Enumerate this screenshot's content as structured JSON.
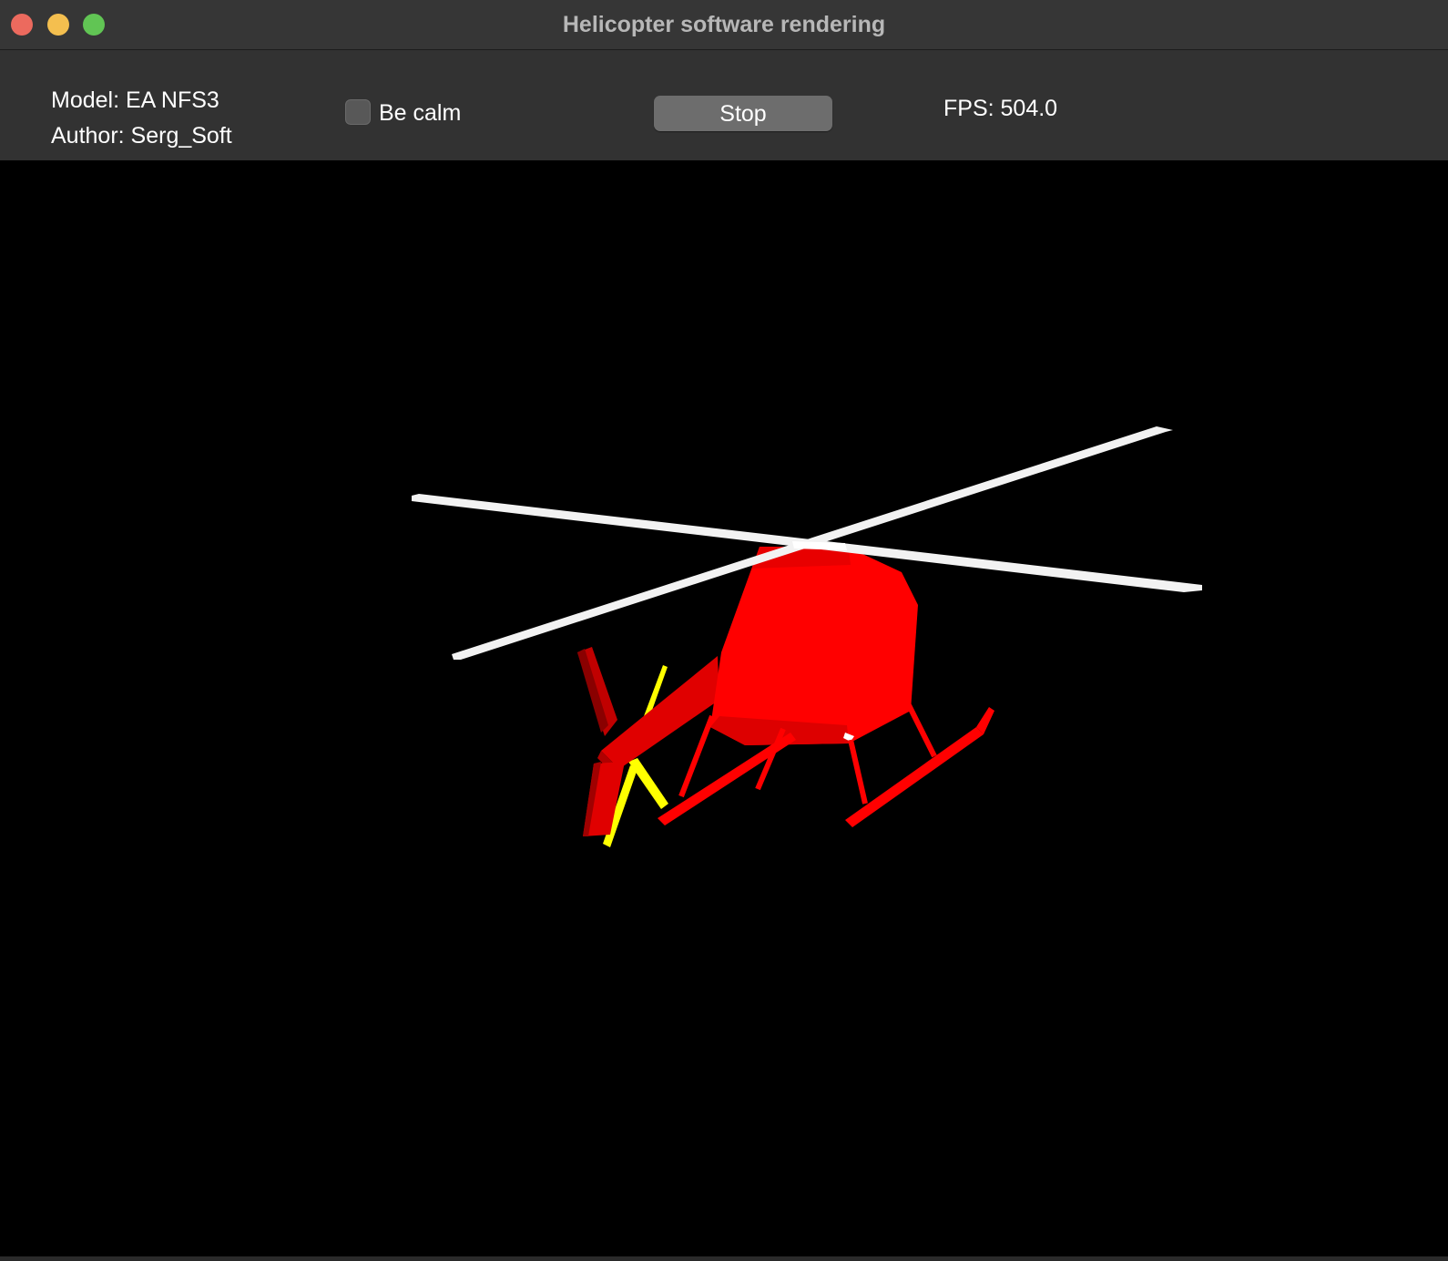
{
  "window": {
    "title": "Helicopter software rendering"
  },
  "toolbar": {
    "model_text": "Model: EA NFS3",
    "author_text": "Author: Serg_Soft",
    "be_calm_label": "Be calm",
    "be_calm_checked": false,
    "stop_label": "Stop",
    "fps_text": "FPS: 504.0"
  },
  "scene": {
    "background_color": "#000000",
    "body_color": "#ff0000",
    "rotor_color": "#ffffff",
    "tail_rotor_color": "#ffff00"
  }
}
